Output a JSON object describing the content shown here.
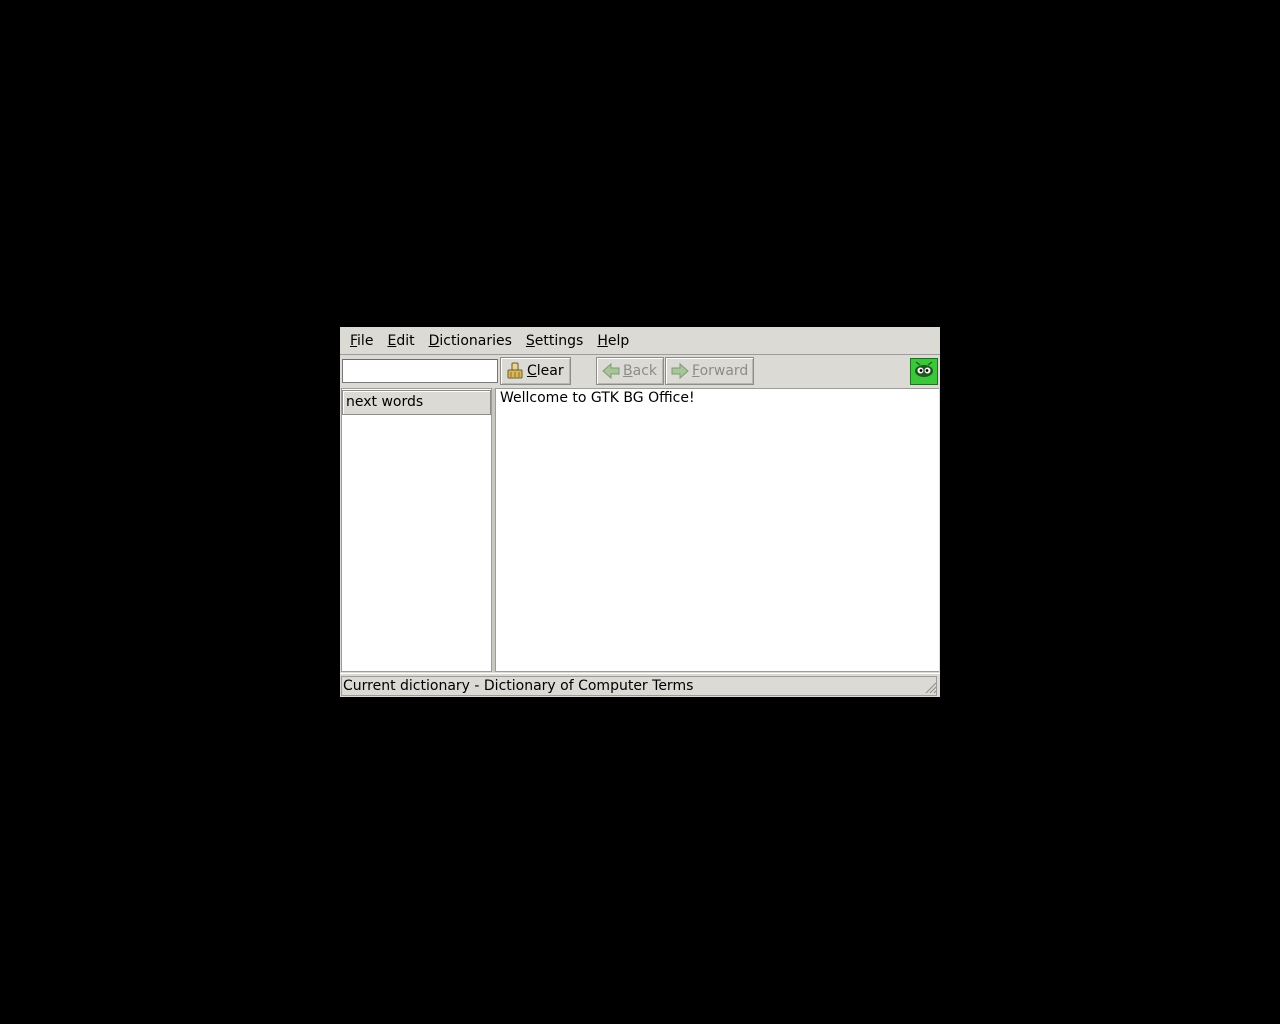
{
  "menubar": {
    "items": [
      {
        "accel": "F",
        "rest": "ile"
      },
      {
        "accel": "E",
        "rest": "dit"
      },
      {
        "accel": "D",
        "rest": "ictionaries"
      },
      {
        "accel": "S",
        "rest": "ettings"
      },
      {
        "accel": "H",
        "rest": "elp"
      }
    ]
  },
  "toolbar": {
    "search": {
      "value": "",
      "placeholder": ""
    },
    "clear": {
      "accel": "C",
      "rest": "lear"
    },
    "back": {
      "accel": "B",
      "rest": "ack"
    },
    "forward": {
      "accel": "F",
      "rest": "orward"
    },
    "logo_icon": "gbo-logo-icon"
  },
  "left_pane": {
    "header": "next words",
    "words": []
  },
  "content": {
    "text": "Wellcome to GTK BG Office!"
  },
  "statusbar": {
    "text": "Current dictionary - Dictionary of Computer Terms"
  },
  "colors": {
    "desktop": "#000000",
    "window_bg": "#dcdad5",
    "pane_bg": "#ffffff",
    "logo_green": "#3cc63c",
    "disabled_text": "#8e8c88"
  }
}
